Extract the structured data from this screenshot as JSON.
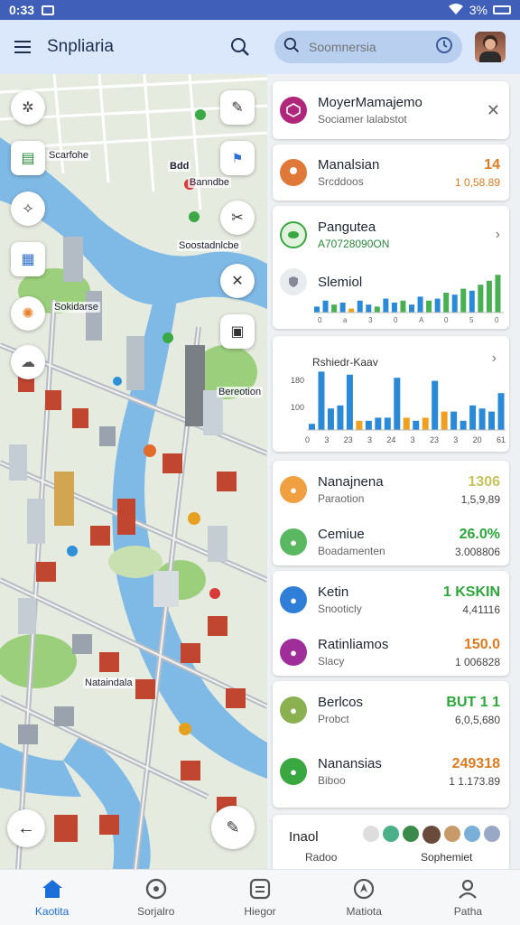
{
  "status": {
    "time": "0:33",
    "battery": "3%"
  },
  "appbar": {
    "title": "Snpliaria",
    "search_placeholder": "Soomnersia",
    "avatar": "user-avatar"
  },
  "map": {
    "labels": [
      "Scarfohe",
      "Banndbe",
      "Soostadnlcbe",
      "Sokidarse",
      "Bereotion",
      "Nataindala"
    ],
    "tag": "Bdd"
  },
  "panel": {
    "card1": {
      "name": "MoyerMamajemo",
      "sub": "Sociamer lalabstot",
      "color": "#b0267a"
    },
    "card2": {
      "name": "Manalsian",
      "sub": "Srcddoos",
      "v1": "14",
      "v2": "1 0,58.89",
      "v1_color": "#e07a1e"
    },
    "card3": {
      "row1": {
        "name": "Pangutea",
        "sub": "A70728090ON"
      },
      "row2": {
        "name": "Slemiol"
      },
      "mini_bars": [
        0.15,
        0.3,
        0.2,
        0.25,
        0.1,
        0.3,
        0.2,
        0.15,
        0.35,
        0.25,
        0.3,
        0.2,
        0.4,
        0.3,
        0.35,
        0.5,
        0.45,
        0.6,
        0.55,
        0.7,
        0.8,
        0.95
      ],
      "mini_bar_colors": [
        "#2a8ad8",
        "#2a8ad8",
        "#47b050",
        "#2a8ad8",
        "#f0a020",
        "#2a8ad8",
        "#2a8ad8",
        "#47b050",
        "#2a8ad8",
        "#2a8ad8",
        "#47b050",
        "#2a8ad8",
        "#2a8ad8",
        "#47b050",
        "#2a8ad8",
        "#47b050",
        "#2a8ad8",
        "#47b050",
        "#2a8ad8",
        "#47b050",
        "#47b050",
        "#47b050"
      ],
      "mini_axis": [
        "0",
        "a",
        "3",
        "0",
        "A",
        "0",
        "5",
        "0"
      ]
    },
    "card4": {
      "title": "Rshiedr-Kaav",
      "y_ticks": [
        "180",
        "100"
      ],
      "x_ticks": [
        "0",
        "3",
        "23",
        "3",
        "24",
        "3",
        "23",
        "3",
        "20",
        "61"
      ]
    },
    "list": [
      {
        "name": "Nanajnena",
        "sub": "Paraotion",
        "v1": "1306",
        "v2": "1,5,9,89",
        "v1_color": "#c8c25a",
        "icon": "home-icon",
        "ic_color": "#f0a040"
      },
      {
        "name": "Cemiue",
        "sub": "Boadamenten",
        "v1": "26.0%",
        "v2": "3.008806",
        "v1_color": "#2aa83a",
        "icon": "leaf-icon",
        "ic_color": "#5ab860"
      },
      {
        "name": "Ketin",
        "sub": "Snooticly",
        "v1": "1 KSKIN",
        "v2": "4,41116",
        "v1_color": "#2aa83a",
        "icon": "globe-icon",
        "ic_color": "#2f7fd8"
      },
      {
        "name": "Ratinliamos",
        "sub": "Slacy",
        "v1": "150.0",
        "v2": "1 006828",
        "v1_color": "#e07a1e",
        "icon": "grid-icon",
        "ic_color": "#a02e9a"
      },
      {
        "name": "Berlcos",
        "sub": "Probct",
        "v1": "BUT 1 1",
        "v2": "6,0,5,680",
        "v1_color": "#2aa83a",
        "icon": "badge-icon",
        "ic_color": "#8ab050"
      },
      {
        "name": "Nanansias",
        "sub": "Biboo",
        "v1": "249318",
        "v2": "1 1.173.89",
        "v1_color": "#e07a1e",
        "icon": "leaf-icon",
        "ic_color": "#3aa840"
      }
    ],
    "footer": {
      "label1": "Inaol",
      "label2": "Radoo",
      "label3": "Sophemiet"
    }
  },
  "bottomnav": [
    {
      "label": "Kaotita",
      "icon": "home-icon",
      "active": true
    },
    {
      "label": "Sorjalro",
      "icon": "compass-icon",
      "active": false
    },
    {
      "label": "Hiegor",
      "icon": "list-icon",
      "active": false
    },
    {
      "label": "Matiota",
      "icon": "navigation-icon",
      "active": false
    },
    {
      "label": "Patha",
      "icon": "person-icon",
      "active": false
    }
  ],
  "colors": {
    "accent": "#1b6fd8",
    "statusbar": "#3f5fb8",
    "appbar": "#dbe8fb",
    "water": "#7fb9e6"
  }
}
